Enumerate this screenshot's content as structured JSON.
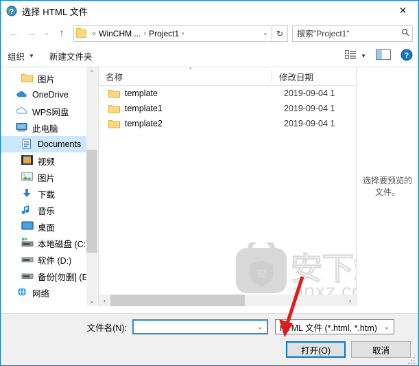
{
  "window": {
    "title": "选择 HTML 文件",
    "title_icon": "help-question-globe-icon",
    "close_label": "✕"
  },
  "nav": {
    "back_icon": "←",
    "forward_icon": "→",
    "recent_icon": "⌄",
    "up_icon": "↑",
    "breadcrumb": {
      "folder_icon": "folder-icon",
      "overflow": "«",
      "items": [
        {
          "label": "WinCHM ...",
          "sep": "›"
        },
        {
          "label": "Project1",
          "sep": "›"
        }
      ],
      "dropdown_icon": "⌄"
    },
    "refresh_icon": "↻",
    "search": {
      "value": "搜索\"Project1\"",
      "icon": "search-icon"
    }
  },
  "toolbar": {
    "organize_label": "组织",
    "organize_caret": "▼",
    "new_folder_label": "新建文件夹",
    "view_icon": "view-layout-icon",
    "view_caret": "▼",
    "preview_pane_icon": "preview-pane-icon",
    "help_icon": "?"
  },
  "sidebar": {
    "items": [
      {
        "label": "图片",
        "icon": "folder-icon",
        "indent": true,
        "selected": false
      },
      {
        "label": "OneDrive",
        "icon": "onedrive-cloud-icon",
        "indent": false,
        "selected": false
      },
      {
        "label": "WPS网盘",
        "icon": "wps-cloud-icon",
        "indent": false,
        "selected": false
      },
      {
        "label": "此电脑",
        "icon": "this-pc-icon",
        "indent": false,
        "selected": false
      },
      {
        "label": "Documents",
        "icon": "documents-icon",
        "indent": true,
        "selected": true
      },
      {
        "label": "视频",
        "icon": "videos-icon",
        "indent": true,
        "selected": false
      },
      {
        "label": "图片",
        "icon": "pictures-icon",
        "indent": true,
        "selected": false
      },
      {
        "label": "下载",
        "icon": "downloads-icon",
        "indent": true,
        "selected": false
      },
      {
        "label": "音乐",
        "icon": "music-icon",
        "indent": true,
        "selected": false
      },
      {
        "label": "桌面",
        "icon": "desktop-icon",
        "indent": true,
        "selected": false
      },
      {
        "label": "本地磁盘 (C:)",
        "icon": "system-drive-icon",
        "indent": true,
        "selected": false
      },
      {
        "label": "软件 (D:)",
        "icon": "drive-icon",
        "indent": true,
        "selected": false
      },
      {
        "label": "备份[勿删] (E:)",
        "icon": "drive-icon",
        "indent": true,
        "selected": false
      },
      {
        "label": "网络",
        "icon": "network-icon",
        "indent": false,
        "selected": false
      }
    ],
    "scroll_up_icon": "⌃",
    "scroll_down_icon": "⌄"
  },
  "filelist": {
    "columns": [
      {
        "key": "name",
        "label": "名称"
      },
      {
        "key": "date",
        "label": "修改日期"
      }
    ],
    "sort_indicator": "⌃",
    "rows": [
      {
        "name": "template",
        "date": "2019-09-04 1",
        "icon": "folder-icon"
      },
      {
        "name": "template1",
        "date": "2019-09-04 1",
        "icon": "folder-icon"
      },
      {
        "name": "template2",
        "date": "2019-09-04 1",
        "icon": "folder-icon"
      }
    ],
    "hscroll_left_icon": "‹",
    "hscroll_right_icon": "›"
  },
  "preview": {
    "message": "选择要预览的文件。"
  },
  "watermark": {
    "badge_text": "安",
    "outline_text": "安下载",
    "site_text": "anxz.com"
  },
  "footer": {
    "filename_label": "文件名(N):",
    "filename_value": "",
    "filename_caret": "⌄",
    "filetype_value": "HTML 文件 (*.html, *.htm)",
    "filetype_caret": "⌄",
    "open_label": "打开(O)",
    "cancel_label": "取消"
  },
  "colors": {
    "accent": "#0078d7",
    "selection": "#cce8ff",
    "folder": "#fdd87d",
    "annotation": "#e01b1b"
  }
}
